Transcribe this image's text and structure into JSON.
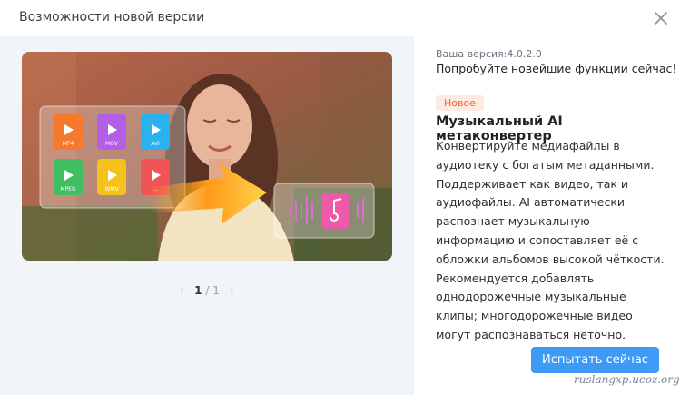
{
  "window": {
    "title": "Возможности новой версии"
  },
  "version": {
    "text": "Ваша версия:4.0.2.0",
    "subtitle": "Попробуйте новейшие функции сейчас!"
  },
  "feature": {
    "badge": "Новое",
    "title": "Музыкальный AI метаконвертер",
    "description": "Конвертируйте медиафайлы в аудиотеку с богатым метаданными. Поддерживает как видео, так и аудиофайлы. AI автоматически распознает музыкальную информацию и сопоставляет её с обложки альбомов высокой чёткости. Рекомендуется добавлять однодорожечные музыкальные клипы; многодорожечные видео могут распознаваться неточно."
  },
  "illustration": {
    "file_icons": [
      {
        "label": "MP4",
        "color": "#f57a2e"
      },
      {
        "label": "MOV",
        "color": "#b35ee6"
      },
      {
        "label": "AVI",
        "color": "#28b3f0"
      },
      {
        "label": "MPEG",
        "color": "#3fbf62"
      },
      {
        "label": "WMV",
        "color": "#f5c21b"
      },
      {
        "label": "...",
        "color": "#f05454"
      }
    ],
    "music_icon_color": "#ef5aa8"
  },
  "pager": {
    "current": "1",
    "total": "1"
  },
  "actions": {
    "try_label": "Испытать сейчас"
  },
  "watermark": {
    "text": "ruslangxp.ucoz.org"
  },
  "colors": {
    "accent": "#3d9bf5",
    "badge_text": "#f0673a",
    "badge_bg": "#fdebe3",
    "left_bg": "#f1f4f8"
  }
}
